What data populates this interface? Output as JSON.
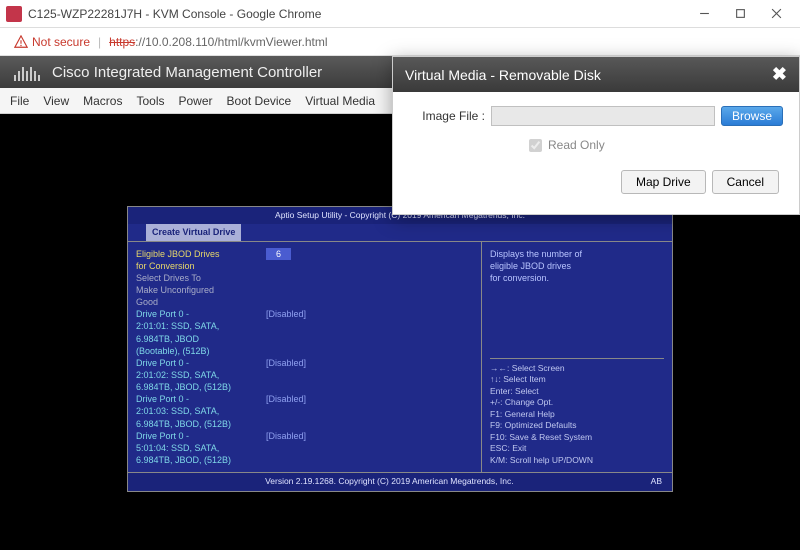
{
  "window": {
    "title": "C125-WZP22281J7H - KVM Console - Google Chrome"
  },
  "urlbar": {
    "warning": "Not secure",
    "proto_strike": "https",
    "url_rest": "://10.0.208.110/html/kvmViewer.html"
  },
  "cisco": {
    "brand": "Cisco",
    "product": "Integrated Management Controller"
  },
  "menubar": {
    "items": [
      "File",
      "View",
      "Macros",
      "Tools",
      "Power",
      "Boot Device",
      "Virtual Media"
    ]
  },
  "modal": {
    "title": "Virtual Media - Removable Disk",
    "image_label": "Image File :",
    "image_value": "",
    "browse": "Browse",
    "read_only": "Read Only",
    "read_only_checked": true,
    "map_drive": "Map Drive",
    "cancel": "Cancel"
  },
  "bios": {
    "top": "Aptio Setup Utility - Copyright (C) 2019 American Megatrends, Inc.",
    "tab": "Create Virtual Drive",
    "left": {
      "l1": "Eligible JBOD Drives",
      "l1v": "6",
      "l2": "for Conversion",
      "l3": "Select Drives To",
      "l4": "Make Unconfigured",
      "l5": "Good",
      "d1a": "Drive Port 0 -",
      "d1s": "[Disabled]",
      "d1b": "2:01:01: SSD, SATA,",
      "d1c": "6.984TB, JBOD",
      "d1d": "(Bootable), (512B)",
      "d2a": "Drive Port 0 -",
      "d2s": "[Disabled]",
      "d2b": "2:01:02: SSD, SATA,",
      "d2c": "6.984TB, JBOD, (512B)",
      "d3a": "Drive Port 0 -",
      "d3s": "[Disabled]",
      "d3b": "2:01:03: SSD, SATA,",
      "d3c": "6.984TB, JBOD, (512B)",
      "d4a": "Drive Port 0 -",
      "d4s": "[Disabled]",
      "d4b": "5:01:04: SSD, SATA,",
      "d4c": "6.984TB, JBOD, (512B)"
    },
    "right": {
      "desc1": "Displays the number of",
      "desc2": "eligible JBOD drives",
      "desc3": "for conversion.",
      "k1": "→←: Select Screen",
      "k2": "↑↓: Select Item",
      "k3": "Enter: Select",
      "k4": "+/-: Change Opt.",
      "k5": "F1: General Help",
      "k6": "F9: Optimized Defaults",
      "k7": "F10: Save & Reset System",
      "k8": "ESC: Exit",
      "k9": "K/M: Scroll help UP/DOWN"
    },
    "foot": "Version 2.19.1268. Copyright (C) 2019 American Megatrends, Inc.",
    "foot_r": "AB"
  }
}
